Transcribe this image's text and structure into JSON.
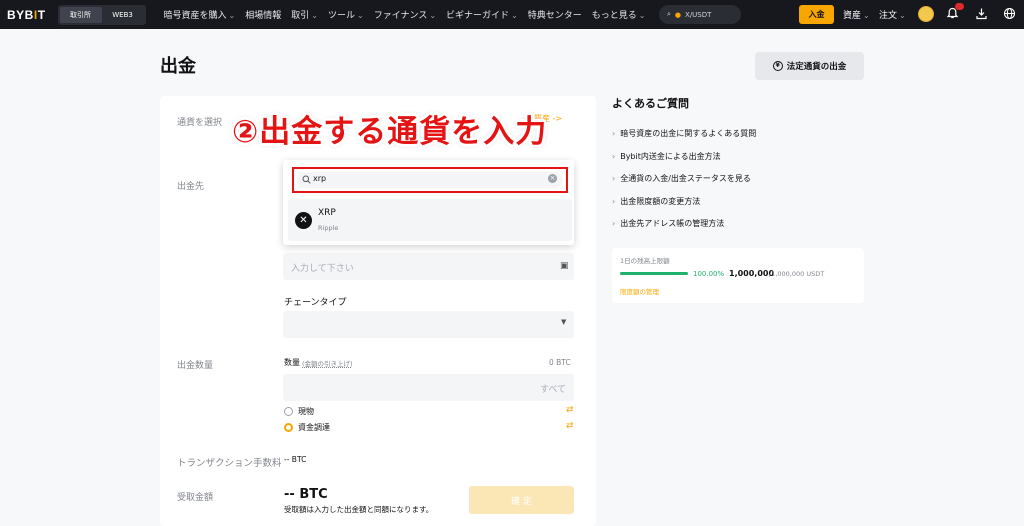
{
  "topbar": {
    "logo": "BYB",
    "logo_accent": "I",
    "logo_tail": "T",
    "tabs": [
      "取引所",
      "WEB3"
    ],
    "nav": [
      "暗号資産を購入",
      "相場情報",
      "取引",
      "ツール",
      "ファイナンス",
      "ビギナーガイド",
      "特典センター",
      "もっと見る"
    ],
    "search_placeholder": "X/USDT",
    "deposit_label": "入金",
    "assets_label": "資産",
    "orders_label": "注文"
  },
  "page": {
    "title": "出金",
    "fiat_button": "法定通貨の出金",
    "fiat_icon": "¥"
  },
  "form": {
    "currency_label": "通貨を選択",
    "currency_link": "質産 ->",
    "destination_label": "出金先",
    "search_value": "xrp",
    "result_symbol": "XRP",
    "result_name": "Ripple",
    "address_placeholder": "入力して下さい",
    "chain_label": "チェーンタイプ",
    "amount_label": "出金数量",
    "quantity_label": "数量",
    "quantity_note": "(金額の引き上げ)",
    "balance": "0 BTC",
    "all_label": "すべて",
    "radio_spot": "現物",
    "radio_funding": "資金調達",
    "fee_label": "トランザクション手数料",
    "fee_value": "-- BTC",
    "receive_label": "受取金額",
    "receive_value": "-- BTC",
    "receive_note": "受取額は入力した出金額と同額になります。",
    "confirm_label": "確 定"
  },
  "faq": {
    "title": "よくあるご質問",
    "items": [
      "暗号資産の出金に関するよくある質問",
      "Bybit内送金による出金方法",
      "全通貨の入金/出金ステータスを見る",
      "出金限度額の変更方法",
      "出金先アドレス帳の管理方法"
    ]
  },
  "limit": {
    "label": "1日の残高上限額",
    "percent": "100.00%",
    "progress": 1.0,
    "used": "1,000,000",
    "total": "/1,000,000 USDT",
    "manage_link": "限度額の管理"
  },
  "annotation": "②出金する通貨を入力",
  "colors": {
    "accent": "#f7a600",
    "annotation": "#e51414",
    "progress": "#20b26c",
    "topbar": "#17181e"
  }
}
